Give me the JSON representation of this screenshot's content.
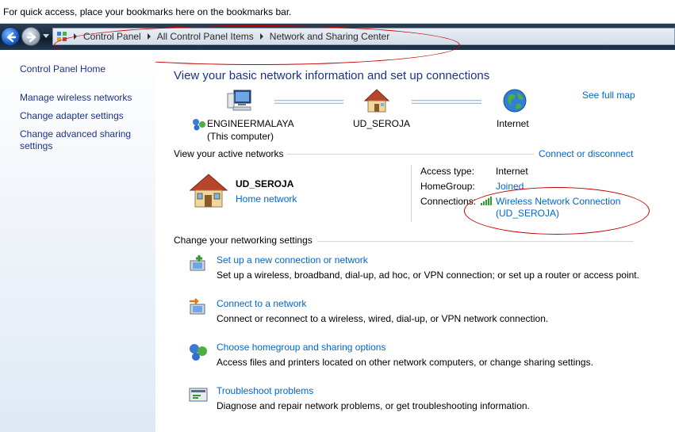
{
  "bookmarks_bar": {
    "text": "For quick access, place your bookmarks here on the bookmarks bar."
  },
  "address_bar": {
    "breadcrumbs": [
      "Control Panel",
      "All Control Panel Items",
      "Network and Sharing Center"
    ]
  },
  "sidebar": {
    "items": [
      {
        "label": "Control Panel Home"
      },
      {
        "label": "Manage wireless networks"
      },
      {
        "label": "Change adapter settings"
      },
      {
        "label": "Change advanced sharing settings"
      }
    ]
  },
  "main": {
    "title": "View your basic network information and set up connections",
    "see_full_map": "See full map",
    "map": {
      "computer_name": "ENGINEERMALAYA",
      "computer_sub": "(This computer)",
      "network_name": "UD_SEROJA",
      "internet": "Internet"
    },
    "active_networks": {
      "heading": "View your active networks",
      "connect_link": "Connect or disconnect",
      "network_name": "UD_SEROJA",
      "network_type": "Home network",
      "access_type_label": "Access type:",
      "access_type_value": "Internet",
      "homegroup_label": "HomeGroup:",
      "homegroup_value": "Joined",
      "connections_label": "Connections:",
      "connection_line1": "Wireless Network Connection",
      "connection_line2": "(UD_SEROJA)"
    },
    "settings": {
      "heading": "Change your networking settings",
      "tasks": [
        {
          "title": "Set up a new connection or network",
          "desc": "Set up a wireless, broadband, dial-up, ad hoc, or VPN connection; or set up a router or access point."
        },
        {
          "title": "Connect to a network",
          "desc": "Connect or reconnect to a wireless, wired, dial-up, or VPN network connection."
        },
        {
          "title": "Choose homegroup and sharing options",
          "desc": "Access files and printers located on other network computers, or change sharing settings."
        },
        {
          "title": "Troubleshoot problems",
          "desc": "Diagnose and repair network problems, or get troubleshooting information."
        }
      ]
    }
  },
  "colors": {
    "link": "#0066cc",
    "title": "#1e3287",
    "annotation": "#c40000"
  }
}
